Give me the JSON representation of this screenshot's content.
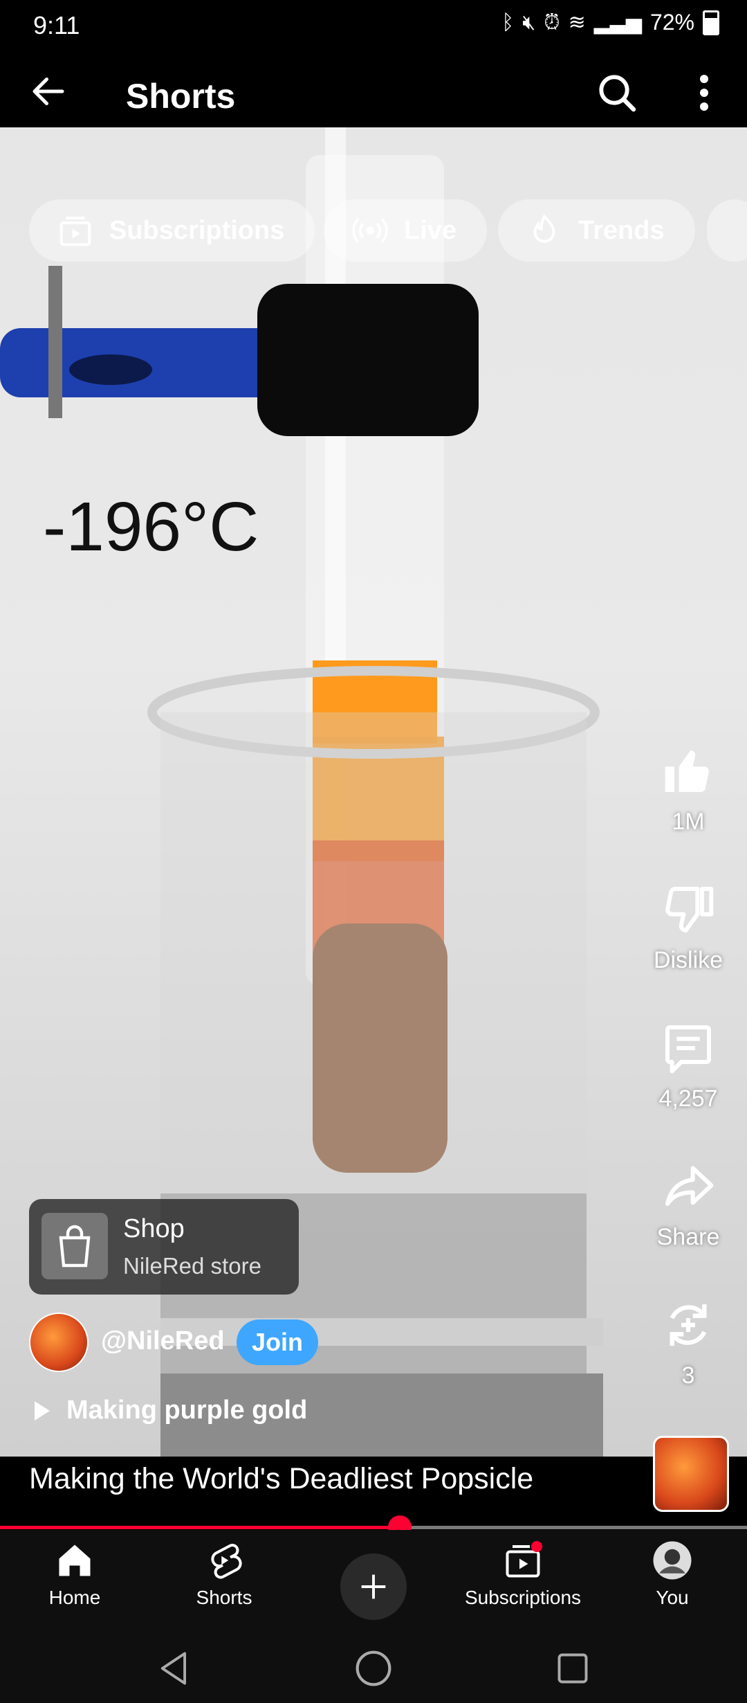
{
  "status": {
    "time": "9:11",
    "battery": "72%"
  },
  "appbar": {
    "title": "Shorts"
  },
  "chips": [
    {
      "label": "Subscriptions",
      "icon": "subscriptions-icon"
    },
    {
      "label": "Live",
      "icon": "live-icon"
    },
    {
      "label": "Trends",
      "icon": "trends-icon"
    }
  ],
  "video": {
    "overlay_text": "-196°C",
    "likes": "1M",
    "dislike_label": "Dislike",
    "comments": "4,257",
    "share_label": "Share",
    "remix_count": "3",
    "shop": {
      "title": "Shop",
      "subtitle": "NileRed store"
    },
    "channel": {
      "handle": "@NileRed",
      "join_label": "Join"
    },
    "playlist": "Making purple gold",
    "title": "Making the World's Deadliest Popsicle",
    "progress": 0.535
  },
  "nav": {
    "home": "Home",
    "shorts": "Shorts",
    "subscriptions": "Subscriptions",
    "you": "You"
  },
  "colors": {
    "accent": "#ff0033",
    "join": "#3ea6ff"
  }
}
